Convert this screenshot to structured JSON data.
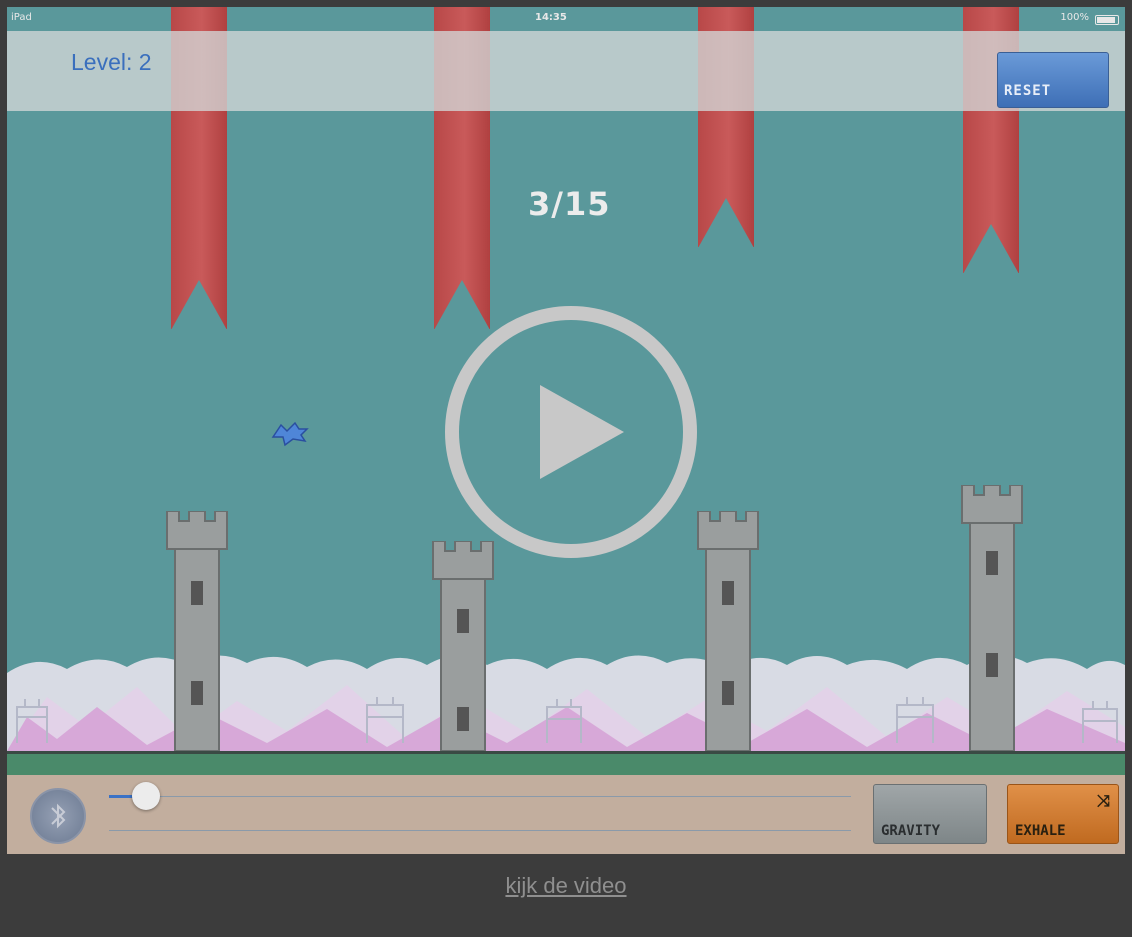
{
  "status_bar": {
    "device": "iPad",
    "time": "14:35",
    "battery": "100%"
  },
  "top_bar": {
    "level_label": "Level: 2",
    "reset_label": "RESET"
  },
  "game": {
    "score": "3/15"
  },
  "controls": {
    "gravity_label": "GRAVITY",
    "exhale_label": "EXHALE",
    "slider_value": 0.05
  },
  "footer": {
    "link_text": "kijk de video"
  },
  "colors": {
    "sky": "#5a989b",
    "banner": "#c05050",
    "tower": "#8c9090",
    "control_bar": "#c2ae9e",
    "exhale": "#d07a30",
    "reset": "#4f7fc4"
  }
}
